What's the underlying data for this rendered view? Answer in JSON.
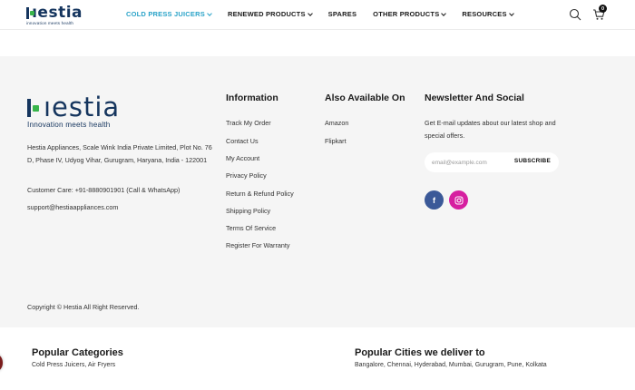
{
  "header": {
    "logo_text": "ıestia",
    "logo_tagline": "innovation meets health",
    "nav": [
      {
        "label": "COLD PRESS JUICERS",
        "has_dropdown": true,
        "active": true
      },
      {
        "label": "RENEWED PRODUCTS",
        "has_dropdown": true,
        "active": false
      },
      {
        "label": "SPARES",
        "has_dropdown": false,
        "active": false
      },
      {
        "label": "OTHER PRODUCTS",
        "has_dropdown": true,
        "active": false
      },
      {
        "label": "RESOURCES",
        "has_dropdown": true,
        "active": false
      }
    ],
    "search_icon": "search-icon",
    "cart_icon": "cart-icon",
    "cart_count": "0"
  },
  "footer": {
    "brand_text": "ıestia",
    "brand_tagline": "Innovation meets health",
    "address": "Hestia Appliances, Scale Wink India Private Limited, Plot No. 76 D, Phase IV, Udyog Vihar, Gurugram, Haryana, India - 122001",
    "customer_care": "Customer Care: +91-8880901901 (Call & WhatsApp)",
    "support_email": "support@hestiaappliances.com",
    "information": {
      "title": "Information",
      "links": [
        "Track My Order",
        "Contact Us",
        "My Account",
        "Privacy Policy",
        "Return & Refund Policy",
        "Shipping Policy",
        "Terms Of Service",
        "Register For Warranty"
      ]
    },
    "available_on": {
      "title": "Also Available On",
      "links": [
        "Amazon",
        "Flipkart"
      ]
    },
    "newsletter": {
      "title": "Newsletter And Social",
      "text": "Get E-mail updates about our latest shop and special offers.",
      "placeholder": "email@example.com",
      "button_label": "SUBSCRIBE"
    },
    "social": {
      "facebook_glyph": "f",
      "instagram_icon": "instagram-icon"
    },
    "copyright": "Copyright © Hestia All Right Reserved."
  },
  "bottom": {
    "categories_title": "Popular Categories",
    "categories_text": "Cold Press Juicers, Air Fryers",
    "cities_title": "Popular Cities we deliver to",
    "cities_text": "Bangalore, Chennai, Hyderabad, Mumbai, Gurugram, Pune, Kolkata"
  },
  "colors": {
    "brand_navy": "#15355e",
    "brand_green": "#38b44a",
    "nav_active": "#2aa3c8",
    "footer_bg": "#f5f5f5",
    "facebook": "#3b5998",
    "instagram": "#d61fa0"
  }
}
